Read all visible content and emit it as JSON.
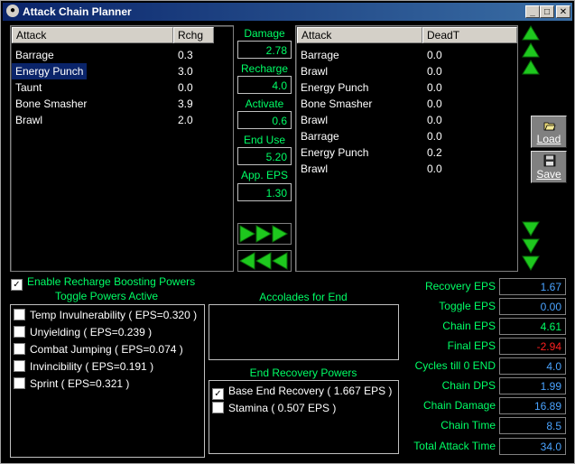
{
  "window": {
    "title": "Attack Chain Planner"
  },
  "attack_list": {
    "headers": {
      "attack": "Attack",
      "rchg": "Rchg"
    },
    "rows": [
      {
        "name": "Barrage",
        "rchg": "0.3"
      },
      {
        "name": "Energy Punch",
        "rchg": "3.0"
      },
      {
        "name": "Taunt",
        "rchg": "0.0"
      },
      {
        "name": "Bone Smasher",
        "rchg": "3.9"
      },
      {
        "name": "Brawl",
        "rchg": "2.0"
      }
    ]
  },
  "stats": {
    "damage": {
      "label": "Damage",
      "value": "2.78"
    },
    "recharge": {
      "label": "Recharge",
      "value": "4.0"
    },
    "activate": {
      "label": "Activate",
      "value": "0.6"
    },
    "end_use": {
      "label": "End Use",
      "value": "5.20"
    },
    "app_eps": {
      "label": "App. EPS",
      "value": "1.30"
    }
  },
  "chain_list": {
    "headers": {
      "attack": "Attack",
      "deadt": "DeadT"
    },
    "rows": [
      {
        "name": "Barrage",
        "deadt": "0.0"
      },
      {
        "name": "Brawl",
        "deadt": "0.0"
      },
      {
        "name": "Energy Punch",
        "deadt": "0.0"
      },
      {
        "name": "Bone Smasher",
        "deadt": "0.0"
      },
      {
        "name": "Brawl",
        "deadt": "0.0"
      },
      {
        "name": "Barrage",
        "deadt": "0.0"
      },
      {
        "name": "Energy Punch",
        "deadt": "0.2"
      },
      {
        "name": "Brawl",
        "deadt": "0.0"
      }
    ]
  },
  "buttons": {
    "load": "Load",
    "save": "Save"
  },
  "recharge_boost": {
    "label": "Enable Recharge Boosting Powers"
  },
  "toggles": {
    "title": "Toggle Powers Active",
    "items": [
      "Temp Invulnerability ( EPS=0.320 )",
      "Unyielding ( EPS=0.239 )",
      "Combat Jumping ( EPS=0.074 )",
      "Invincibility ( EPS=0.191 )",
      "Sprint ( EPS=0.321 )"
    ]
  },
  "accolades": {
    "title": "Accolades for End"
  },
  "end_recovery": {
    "title": "End Recovery Powers",
    "items": [
      {
        "label": "Base End Recovery ( 1.667 EPS )",
        "checked": true
      },
      {
        "label": "Stamina ( 0.507 EPS )",
        "checked": false
      }
    ]
  },
  "results": [
    {
      "label": "Recovery EPS",
      "value": "1.67",
      "color": "#4aa3ff"
    },
    {
      "label": "Toggle EPS",
      "value": "0.00",
      "color": "#4aa3ff"
    },
    {
      "label": "Chain EPS",
      "value": "4.61",
      "color": "#00ff66"
    },
    {
      "label": "Final EPS",
      "value": "-2.94",
      "color": "#ff2020"
    },
    {
      "label": "Cycles till 0 END",
      "value": "4.0",
      "color": "#4aa3ff"
    },
    {
      "label": "Chain DPS",
      "value": "1.99",
      "color": "#4aa3ff"
    },
    {
      "label": "Chain Damage",
      "value": "16.89",
      "color": "#4aa3ff"
    },
    {
      "label": "Chain Time",
      "value": "8.5",
      "color": "#4aa3ff"
    },
    {
      "label": "Total Attack Time",
      "value": "34.0",
      "color": "#4aa3ff"
    }
  ],
  "colors": {
    "accent_green": "#00ff66",
    "value_blue": "#4aa3ff",
    "negative_red": "#ff2020",
    "title_bar": "#0a246a"
  },
  "icons": {
    "app": "app-icon",
    "up": "green-up-arrow-icon",
    "down": "green-down-arrow-icon",
    "right": "green-right-arrow-icon",
    "left": "green-left-arrow-icon",
    "load": "folder-open-icon",
    "save": "floppy-disk-icon"
  }
}
